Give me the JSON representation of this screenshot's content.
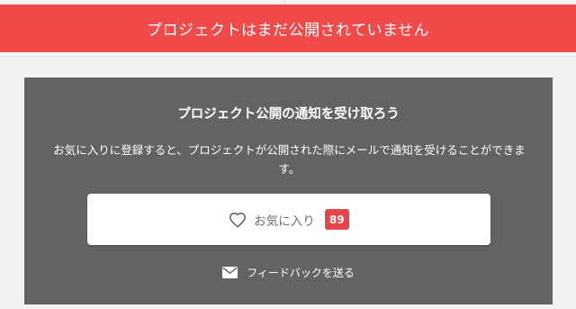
{
  "banner": {
    "text": "プロジェクトはまだ公開されていません",
    "color": "#f04a4b"
  },
  "card": {
    "title": "プロジェクト公開の通知を受け取ろう",
    "description": "お気に入りに登録すると、プロジェクトが公開された際にメールで通知を受けることができます。",
    "color": "#636363"
  },
  "favorite": {
    "icon": "heart-outline-icon",
    "label": "お気に入り",
    "count": "89",
    "badge_color": "#e8454b"
  },
  "feedback": {
    "icon": "envelope-icon",
    "label": "フィードバックを送る"
  }
}
